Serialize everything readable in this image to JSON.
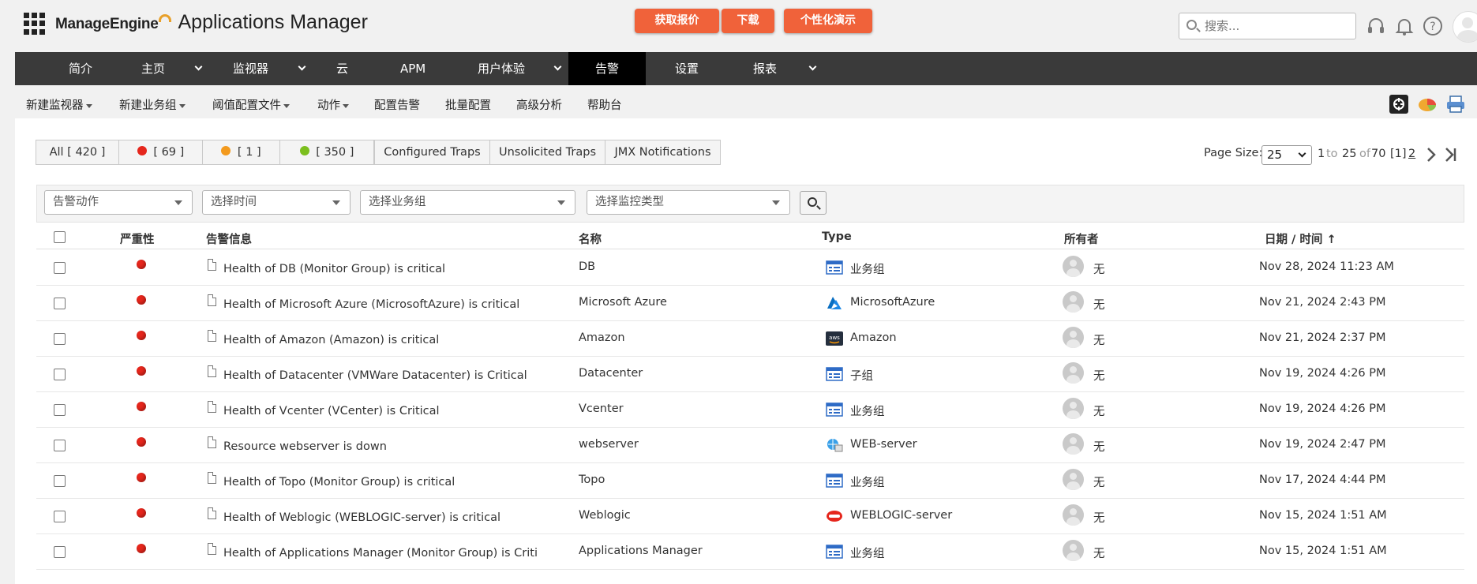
{
  "brand": {
    "company": "ManageEngine",
    "product": "Applications Manager"
  },
  "header": {
    "cta_quote": "获取报价",
    "cta_download": "下载",
    "cta_demo": "个性化演示",
    "search_placeholder": "搜索..."
  },
  "nav": [
    {
      "label": "简介",
      "chevron": false,
      "active": false
    },
    {
      "label": "主页",
      "chevron": true,
      "active": false
    },
    {
      "label": "监视器",
      "chevron": true,
      "active": false
    },
    {
      "label": "云",
      "chevron": false,
      "active": false
    },
    {
      "label": "APM",
      "chevron": false,
      "active": false
    },
    {
      "label": "用户体验",
      "chevron": true,
      "active": false
    },
    {
      "label": "告警",
      "chevron": false,
      "active": true
    },
    {
      "label": "设置",
      "chevron": false,
      "active": false
    },
    {
      "label": "报表",
      "chevron": true,
      "active": false
    }
  ],
  "subnav": [
    {
      "label": "新建监视器",
      "dropdown": true
    },
    {
      "label": "新建业务组",
      "dropdown": true
    },
    {
      "label": "阈值配置文件",
      "dropdown": true
    },
    {
      "label": "动作",
      "dropdown": true
    },
    {
      "label": "配置告警",
      "dropdown": false
    },
    {
      "label": "批量配置",
      "dropdown": false
    },
    {
      "label": "高级分析",
      "dropdown": false
    },
    {
      "label": "帮助台",
      "dropdown": false
    }
  ],
  "filters": {
    "all": "All [ 420 ]",
    "critical": "[ 69 ]",
    "warning": "[ 1 ]",
    "clear": "[ 350 ]",
    "configured_traps": "Configured Traps",
    "unsolicited_traps": "Unsolicited Traps",
    "jmx": "JMX Notifications",
    "colors": {
      "critical": "#e5261c",
      "warning": "#f39a1e",
      "clear": "#7cbf1e"
    }
  },
  "paging": {
    "page_size_label": "Page Size:",
    "page_size": "25",
    "from": "1",
    "to_word": "to",
    "to": "25",
    "of_word": "of",
    "total": "70",
    "current_page": "[1]",
    "next_page": "2"
  },
  "selects": {
    "action": "告警动作",
    "time": "选择时间",
    "group": "选择业务组",
    "monitor_type": "选择监控类型"
  },
  "table": {
    "headers": {
      "severity": "严重性",
      "message": "告警信息",
      "name": "名称",
      "type": "Type",
      "owner": "所有者",
      "datetime": "日期 / 时间 ↑"
    },
    "rows": [
      {
        "message": "Health of DB (Monitor Group) is critical",
        "name": "DB",
        "type": "业务组",
        "type_icon": "monitor-group-icon",
        "owner": "无",
        "datetime": "Nov 28, 2024 11:23 AM"
      },
      {
        "message": "Health of Microsoft Azure (MicrosoftAzure) is critical",
        "name": "Microsoft Azure",
        "type": "MicrosoftAzure",
        "type_icon": "azure-icon",
        "owner": "无",
        "datetime": "Nov 21, 2024 2:43 PM"
      },
      {
        "message": "Health of Amazon (Amazon) is critical",
        "name": "Amazon",
        "type": "Amazon",
        "type_icon": "aws-icon",
        "owner": "无",
        "datetime": "Nov 21, 2024 2:37 PM"
      },
      {
        "message": "Health of Datacenter (VMWare Datacenter) is Critical",
        "name": "Datacenter",
        "type": "子组",
        "type_icon": "subgroup-icon",
        "owner": "无",
        "datetime": "Nov 19, 2024 4:26 PM"
      },
      {
        "message": "Health of Vcenter (VCenter) is Critical",
        "name": "Vcenter",
        "type": "业务组",
        "type_icon": "monitor-group-icon",
        "owner": "无",
        "datetime": "Nov 19, 2024 4:26 PM"
      },
      {
        "message": "Resource webserver is down",
        "name": "webserver",
        "type": "WEB-server",
        "type_icon": "web-server-icon",
        "owner": "无",
        "datetime": "Nov 19, 2024 2:47 PM"
      },
      {
        "message": "Health of Topo (Monitor Group) is critical",
        "name": "Topo",
        "type": "业务组",
        "type_icon": "monitor-group-icon",
        "owner": "无",
        "datetime": "Nov 17, 2024 4:44 PM"
      },
      {
        "message": "Health of Weblogic (WEBLOGIC-server) is critical",
        "name": "Weblogic",
        "type": "WEBLOGIC-server",
        "type_icon": "weblogic-icon",
        "owner": "无",
        "datetime": "Nov 15, 2024 1:51 AM"
      },
      {
        "message": "Health of Applications Manager (Monitor Group) is Criti",
        "name": "Applications Manager",
        "type": "业务组",
        "type_icon": "monitor-group-icon",
        "owner": "无",
        "datetime": "Nov 15, 2024 1:51 AM"
      }
    ]
  }
}
